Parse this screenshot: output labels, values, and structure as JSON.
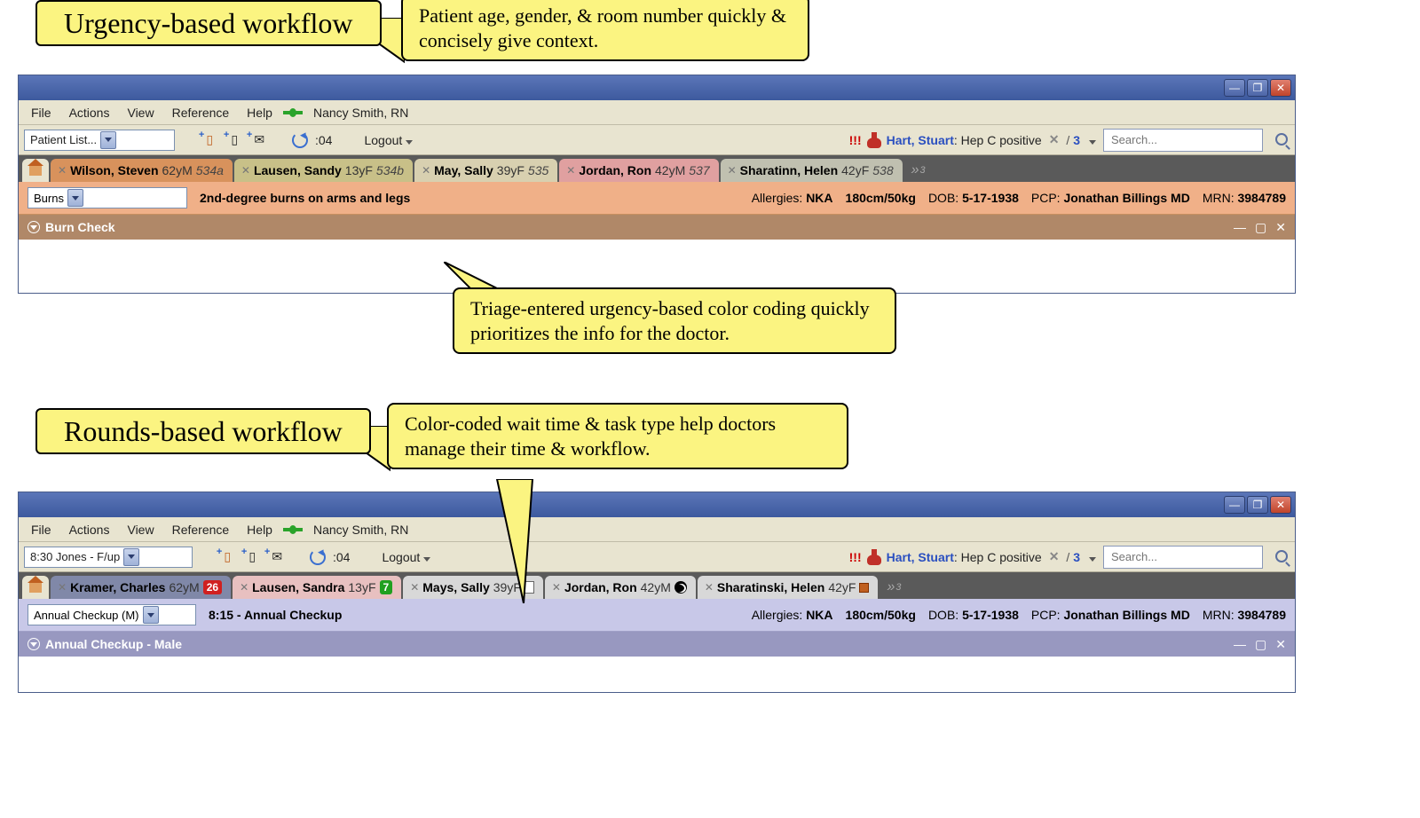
{
  "callouts": {
    "title1": "Urgency-based workflow",
    "bubble1": "Patient age, gender, & room number quickly & concisely give context.",
    "bubble2": "Triage-entered urgency-based color coding quickly prioritizes the info for the doctor.",
    "title2": "Rounds-based workflow",
    "bubble3": "Color-coded wait time & task type help doctors manage their time & workflow."
  },
  "menu": {
    "file": "File",
    "actions": "Actions",
    "view": "View",
    "reference": "Reference",
    "help": "Help",
    "user": "Nancy Smith, RN",
    "refresh_time": ":04",
    "logout": "Logout"
  },
  "alert": {
    "name": "Hart, Stuart",
    "text": "Hep C positive",
    "count": "3",
    "bang": "!!!"
  },
  "search": {
    "placeholder": "Search..."
  },
  "top": {
    "picker": "Patient List...",
    "tabs": [
      {
        "name": "Wilson, Steven",
        "meta": "62yM",
        "room": "534a"
      },
      {
        "name": "Lausen, Sandy",
        "meta": "13yF",
        "room": "534b"
      },
      {
        "name": "May, Sally",
        "meta": "39yF",
        "room": "535"
      },
      {
        "name": "Jordan, Ron",
        "meta": "42yM",
        "room": "537"
      },
      {
        "name": "Sharatinn, Helen",
        "meta": "42yF",
        "room": "538"
      }
    ],
    "overflow": "3",
    "header": {
      "category": "Burns",
      "desc": "2nd-degree burns on arms and legs",
      "allergies_label": "Allergies:",
      "allergies": "NKA",
      "vitals": "180cm/50kg",
      "dob_label": "DOB:",
      "dob": "5-17-1938",
      "pcp_label": "PCP:",
      "pcp": "Jonathan Billings MD",
      "mrn_label": "MRN:",
      "mrn": "3984789"
    },
    "section": "Burn Check"
  },
  "bottom": {
    "picker": "8:30 Jones - F/up",
    "tabs": [
      {
        "name": "Kramer, Charles",
        "meta": "62yM",
        "badge": "26"
      },
      {
        "name": "Lausen, Sandra",
        "meta": "13yF",
        "badge": "7"
      },
      {
        "name": "Mays, Sally",
        "meta": "39yF"
      },
      {
        "name": "Jordan, Ron",
        "meta": "42yM"
      },
      {
        "name": "Sharatinski, Helen",
        "meta": "42yF"
      }
    ],
    "overflow": "3",
    "header": {
      "category": "Annual Checkup (M)",
      "desc": "8:15 - Annual Checkup",
      "allergies_label": "Allergies:",
      "allergies": "NKA",
      "vitals": "180cm/50kg",
      "dob_label": "DOB:",
      "dob": "5-17-1938",
      "pcp_label": "PCP:",
      "pcp": "Jonathan Billings MD",
      "mrn_label": "MRN:",
      "mrn": "3984789"
    },
    "section": "Annual Checkup - Male"
  }
}
